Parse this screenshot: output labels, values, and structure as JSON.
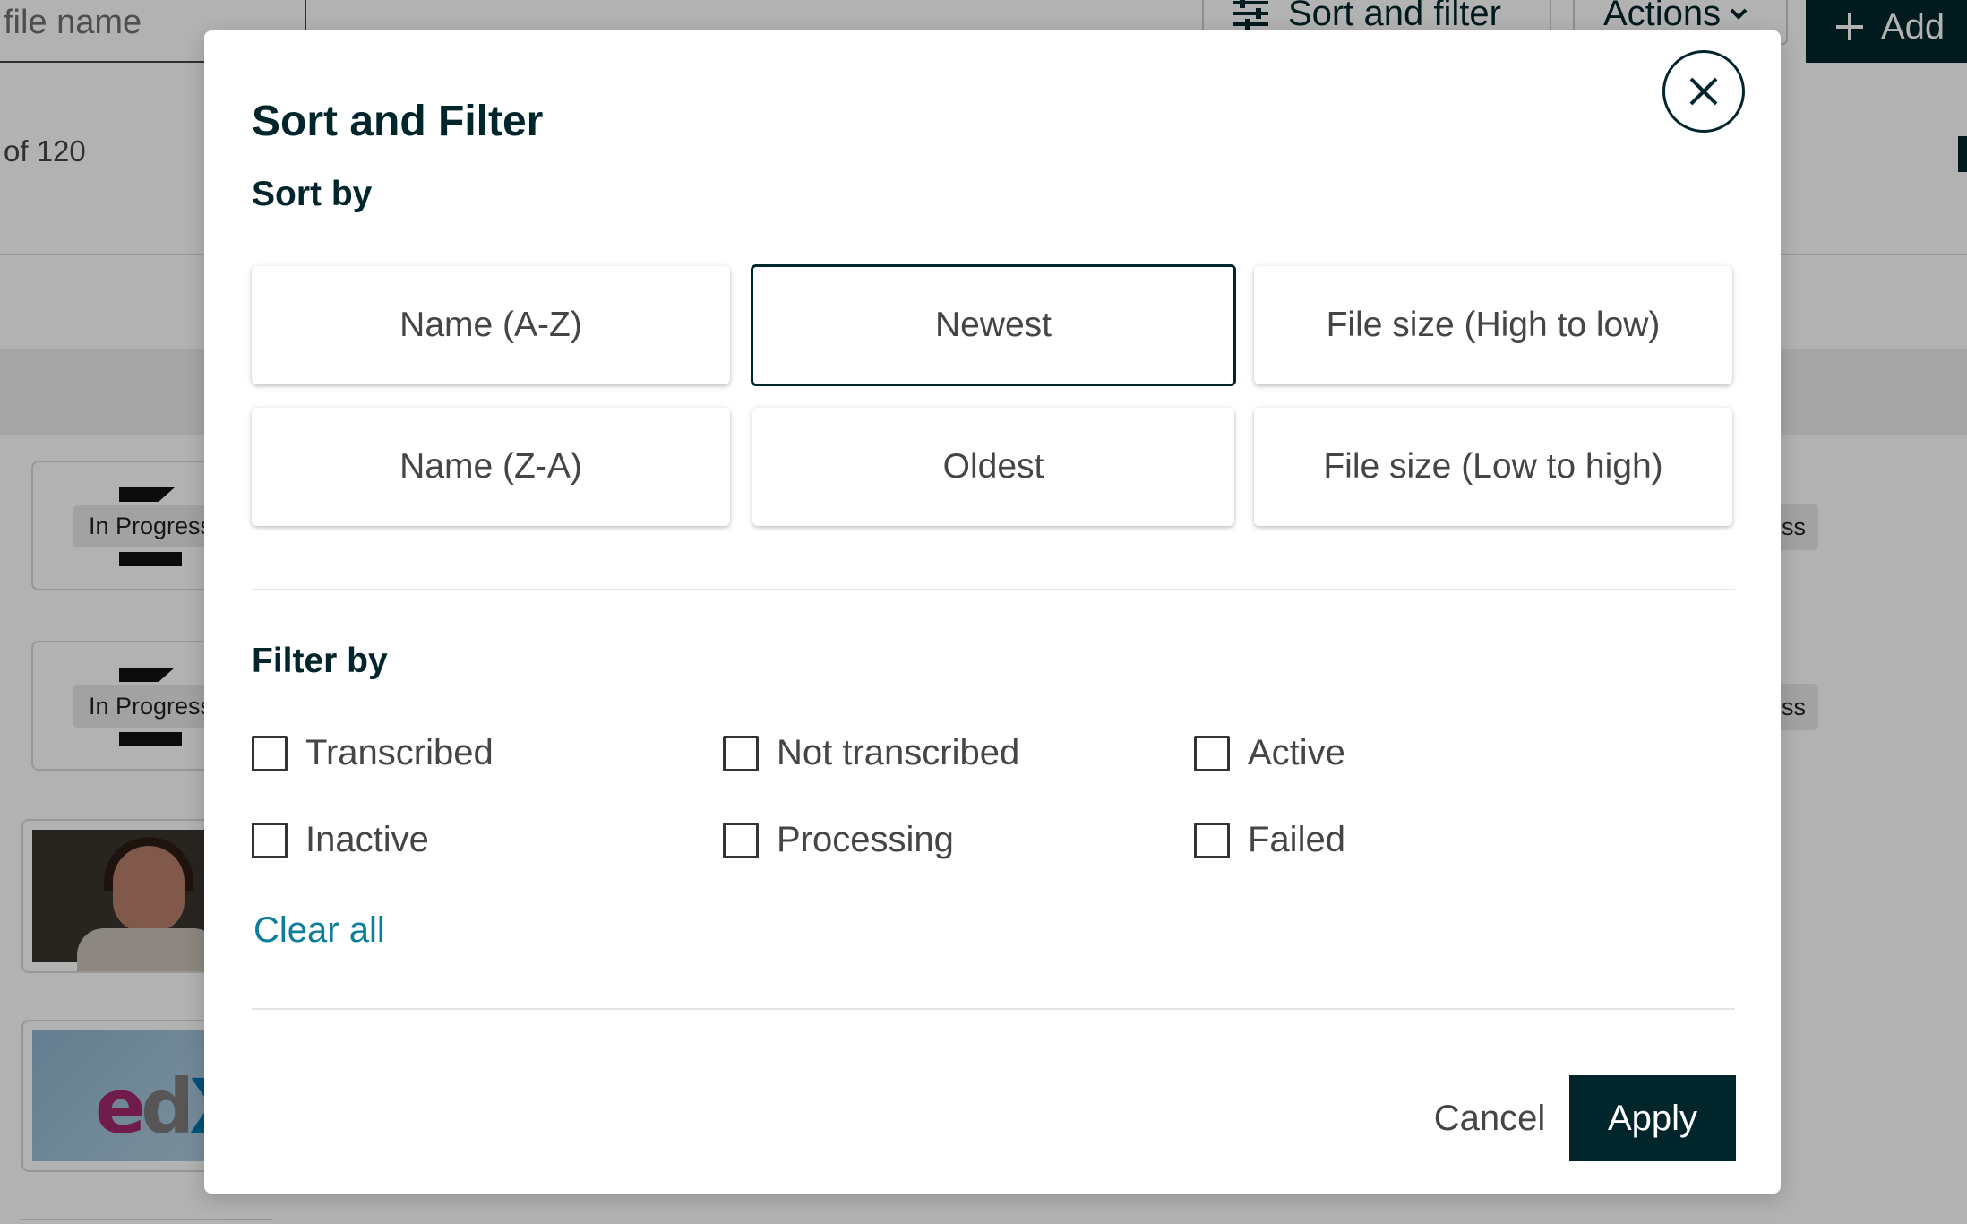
{
  "background": {
    "search_placeholder": "file name",
    "sort_filter_button": "Sort and filter",
    "actions_button": "Actions",
    "add_button": "Add",
    "count_text": "of 120",
    "status_badge": "In Progress",
    "status_badge_right": "ss"
  },
  "modal": {
    "title": "Sort and Filter",
    "sort_heading": "Sort by",
    "sort_options": [
      {
        "label": "Name (A-Z)",
        "selected": false
      },
      {
        "label": "Newest",
        "selected": true
      },
      {
        "label": "File size (High to low)",
        "selected": false
      },
      {
        "label": "Name (Z-A)",
        "selected": false
      },
      {
        "label": "Oldest",
        "selected": false
      },
      {
        "label": "File size (Low to high)",
        "selected": false
      }
    ],
    "filter_heading": "Filter by",
    "filters": [
      {
        "label": "Transcribed",
        "checked": false
      },
      {
        "label": "Not transcribed",
        "checked": false
      },
      {
        "label": "Active",
        "checked": false
      },
      {
        "label": "Inactive",
        "checked": false
      },
      {
        "label": "Processing",
        "checked": false
      },
      {
        "label": "Failed",
        "checked": false
      }
    ],
    "clear_all": "Clear all",
    "cancel_label": "Cancel",
    "apply_label": "Apply"
  },
  "icons": {
    "close": "close-icon",
    "sliders": "sliders-icon",
    "chevron": "chevron-down-icon",
    "plus": "plus-icon"
  },
  "colors": {
    "primary": "#00262b",
    "link": "#0d7d9c",
    "text": "#454545"
  }
}
